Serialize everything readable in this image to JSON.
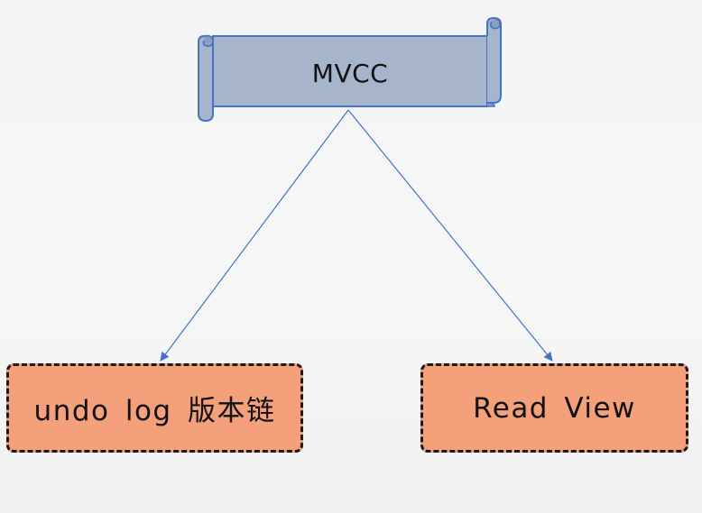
{
  "diagram": {
    "root": {
      "label": "MVCC",
      "fill_color": "#a6b4cc",
      "stroke_color": "#4472c4"
    },
    "children": [
      {
        "label": "undo log 版本链",
        "fill_color": "#f4a07a"
      },
      {
        "label": "Read View",
        "fill_color": "#f4a07a"
      }
    ],
    "edge_color": "#4472c4",
    "edges": [
      {
        "from": "MVCC",
        "to": "undo log 版本链"
      },
      {
        "from": "MVCC",
        "to": "Read View"
      }
    ]
  }
}
